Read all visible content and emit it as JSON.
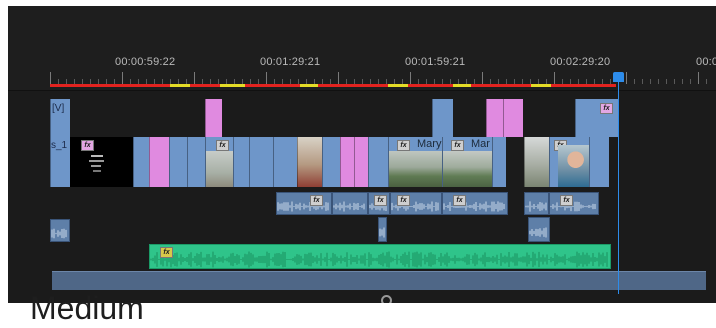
{
  "timeline": {
    "timecodes": [
      "00:00:59:22",
      "00:01:29:21",
      "00:01:59:21",
      "00:02:29:20",
      "00:0"
    ],
    "tracks": {
      "v2_label": "[V]",
      "v1_label": "s_1"
    },
    "clip_labels": {
      "mary_1": "Mary",
      "mary_2": "Mar"
    },
    "fx_badge": "fx",
    "colors": {
      "video_clip": "#6e96c9",
      "pink_clip": "#e08ae0",
      "audio_clip": "#5e7fa8",
      "music_clip": "#2fc48a",
      "playhead": "#2d8ceb",
      "work_area_red": "#e3231f",
      "work_area_yellow": "#e4dc27"
    }
  },
  "zoom": {
    "label": "Medium"
  }
}
